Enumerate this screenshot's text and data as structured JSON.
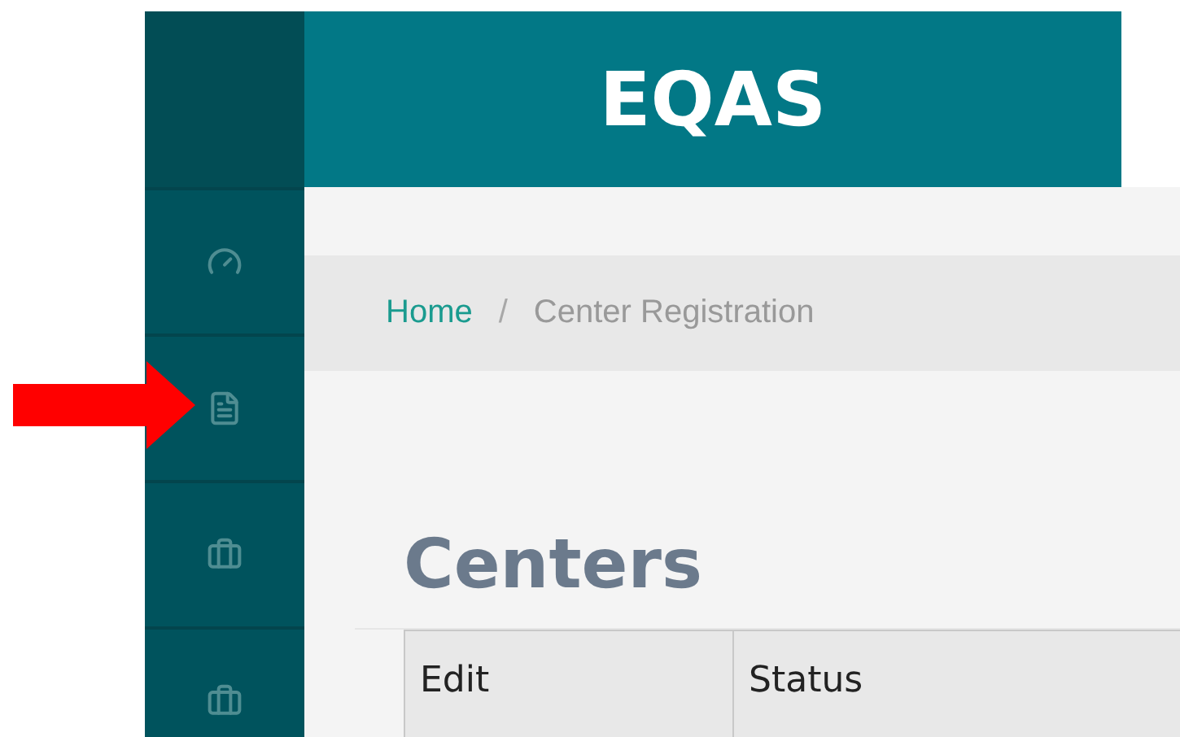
{
  "header": {
    "title": "EQAS"
  },
  "sidebar": {
    "items": [
      {
        "kind": "gauge"
      },
      {
        "kind": "file"
      },
      {
        "kind": "briefcase"
      },
      {
        "kind": "briefcase"
      }
    ]
  },
  "breadcrumb": [
    {
      "label": "Home",
      "kind": "link"
    },
    {
      "label": "Center Registration",
      "kind": "current"
    }
  ],
  "breadcrumb_separator": "/",
  "page_title": "Centers",
  "table": {
    "columns": [
      "Edit",
      "Status"
    ]
  }
}
